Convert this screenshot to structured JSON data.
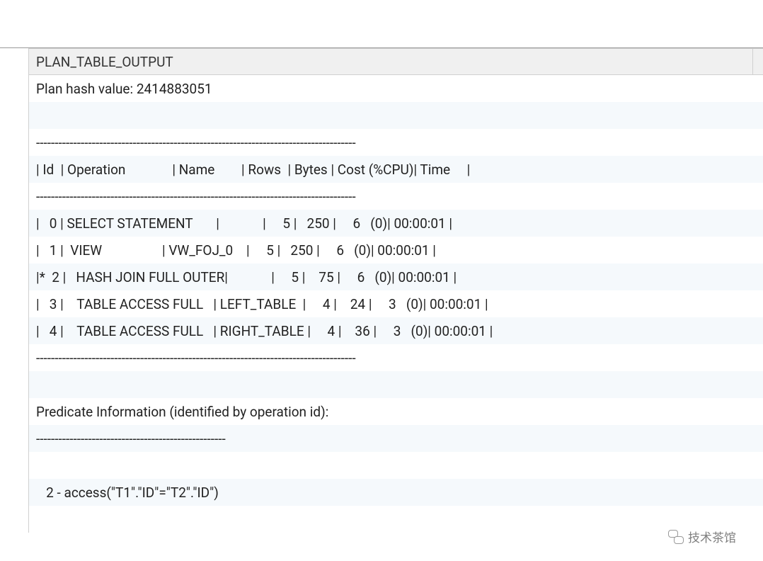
{
  "header": {
    "column_name": "PLAN_TABLE_OUTPUT"
  },
  "rows": [
    "Plan hash value: 2414883051",
    " ",
    "--------------------------------------------------------------------------------------",
    "| Id  | Operation              | Name        | Rows  | Bytes | Cost (%CPU)| Time     |",
    "--------------------------------------------------------------------------------------",
    "|   0 | SELECT STATEMENT       |             |     5 |   250 |     6   (0)| 00:00:01 |",
    "|   1 |  VIEW                  | VW_FOJ_0    |     5 |   250 |     6   (0)| 00:00:01 |",
    "|*  2 |   HASH JOIN FULL OUTER|             |     5 |    75 |     6   (0)| 00:00:01 |",
    "|   3 |    TABLE ACCESS FULL   | LEFT_TABLE  |     4 |    24 |     3   (0)| 00:00:01 |",
    "|   4 |    TABLE ACCESS FULL   | RIGHT_TABLE |     4 |    36 |     3   (0)| 00:00:01 |",
    "--------------------------------------------------------------------------------------",
    " ",
    "Predicate Information (identified by operation id):",
    "---------------------------------------------------",
    " ",
    "   2 - access(\"T1\".\"ID\"=\"T2\".\"ID\")",
    " "
  ],
  "watermark": {
    "text": "技术茶馆"
  }
}
